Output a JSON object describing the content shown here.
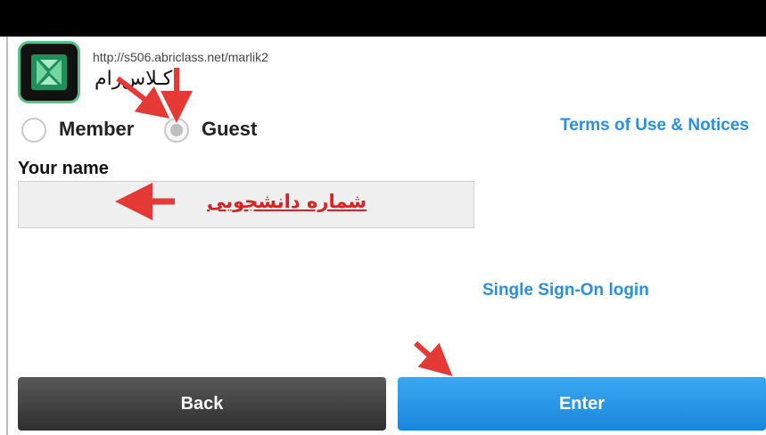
{
  "header": {
    "url": "http://s506.abriclass.net/marlik2",
    "room_name": "کـلاس‌رام"
  },
  "login_type": {
    "member_label": "Member",
    "guest_label": "Guest",
    "selected": "Guest"
  },
  "links": {
    "terms": "Terms of Use & Notices",
    "sso": "Single Sign-On login"
  },
  "name_section": {
    "label": "Your name",
    "value": "شماره دانشجویی"
  },
  "buttons": {
    "back": "Back",
    "enter": "Enter"
  },
  "colors": {
    "link": "#2b8fdc",
    "annotation_arrow": "#e53935",
    "enter_button": "#1f8fe0",
    "back_button": "#3f3f3f",
    "top_bar": "#000000"
  },
  "icons": {
    "app": "adobe-connect-icon",
    "annotation": "red-arrow-icon"
  }
}
